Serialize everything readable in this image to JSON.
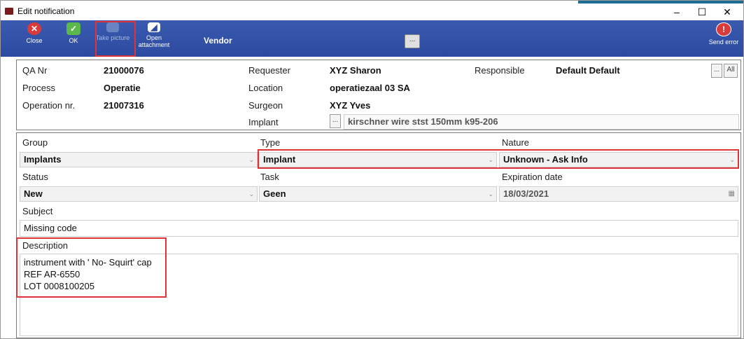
{
  "window": {
    "title": "Edit notification",
    "controls": {
      "minimize": "–",
      "maximize": "☐",
      "close": "✕"
    }
  },
  "toolbar": {
    "close": "Close",
    "ok": "OK",
    "take_picture": "Take picture",
    "open_attachment_1": "Open",
    "open_attachment_2": "attachment",
    "vendor": "Vendor",
    "middle_button": "...",
    "send_error": "Send error"
  },
  "header": {
    "qa_label": "QA Nr",
    "qa_value": "21000076",
    "process_label": "Process",
    "process_value": "Operatie",
    "operation_label": "Operation nr.",
    "operation_value": "21007316",
    "requester_label": "Requester",
    "requester_value": "XYZ Sharon",
    "location_label": "Location",
    "location_value": "operatiezaal 03 SA",
    "surgeon_label": "Surgeon",
    "surgeon_value": "XYZ Yves",
    "implant_label": "Implant",
    "implant_value": "kirschner wire stst 150mm k95-206",
    "implant_btn": "...",
    "responsible_label": "Responsible",
    "responsible_value": "Default Default",
    "resp_btn": "...",
    "all_btn": "All"
  },
  "form": {
    "group_label": "Group",
    "group_value": "Implants",
    "type_label": "Type",
    "type_value": "Implant",
    "nature_label": "Nature",
    "nature_value": "Unknown - Ask Info",
    "status_label": "Status",
    "status_value": "New",
    "task_label": "Task",
    "task_value": "Geen",
    "exp_label": "Expiration date",
    "exp_value": "18/03/2021",
    "subject_label": "Subject",
    "subject_value": "Missing code",
    "description_label": "Description",
    "description_lines": [
      "instrument with ' No- Squirt' cap",
      "REF AR-6550",
      "LOT 0008100205"
    ]
  },
  "colors": {
    "toolbar": "#2c4aa0",
    "highlight": "#e03434",
    "close_icon": "#d93a3a",
    "ok_icon": "#5cb84a",
    "send_error_icon": "#d93a3a"
  }
}
